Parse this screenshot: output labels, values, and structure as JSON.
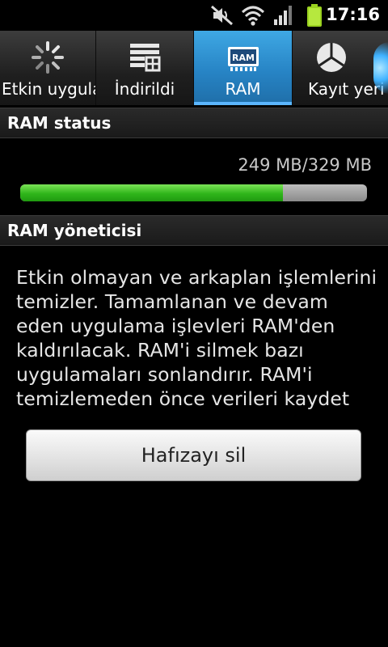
{
  "status_bar": {
    "time": "17:16",
    "icons": [
      "mute-icon",
      "wifi-icon",
      "signal-icon",
      "battery-icon"
    ],
    "battery_color": "#9ad21f"
  },
  "tabs": [
    {
      "label": "Etkin uygulan",
      "icon": "loading-spinner-icon",
      "active": false
    },
    {
      "label": "İndirildi",
      "icon": "downloads-grid-icon",
      "active": false
    },
    {
      "label": "RAM",
      "icon": "ram-chip-icon",
      "active": true
    },
    {
      "label": "Kayıt yeri",
      "icon": "pie-chart-icon",
      "active": false
    }
  ],
  "ram_chip_text": "RAM",
  "ram_status": {
    "header": "RAM status",
    "value_text": "249 MB/329 MB",
    "used_fraction": 0.757
  },
  "ram_manager": {
    "header": "RAM yöneticisi",
    "description": "Etkin olmayan ve arkaplan işlemlerini temizler. Tamamlanan ve devam eden uygulama işlevleri RAM'den kaldırılacak. RAM'i silmek bazı uygulamaları sonlandırır. RAM'i temizlemeden önce verileri kaydet",
    "button_label": "Hafızayı sil"
  },
  "colors": {
    "active_tab": "#2784c5",
    "progress_fill": "#2fb51a",
    "progress_track": "#9a9a9a"
  }
}
